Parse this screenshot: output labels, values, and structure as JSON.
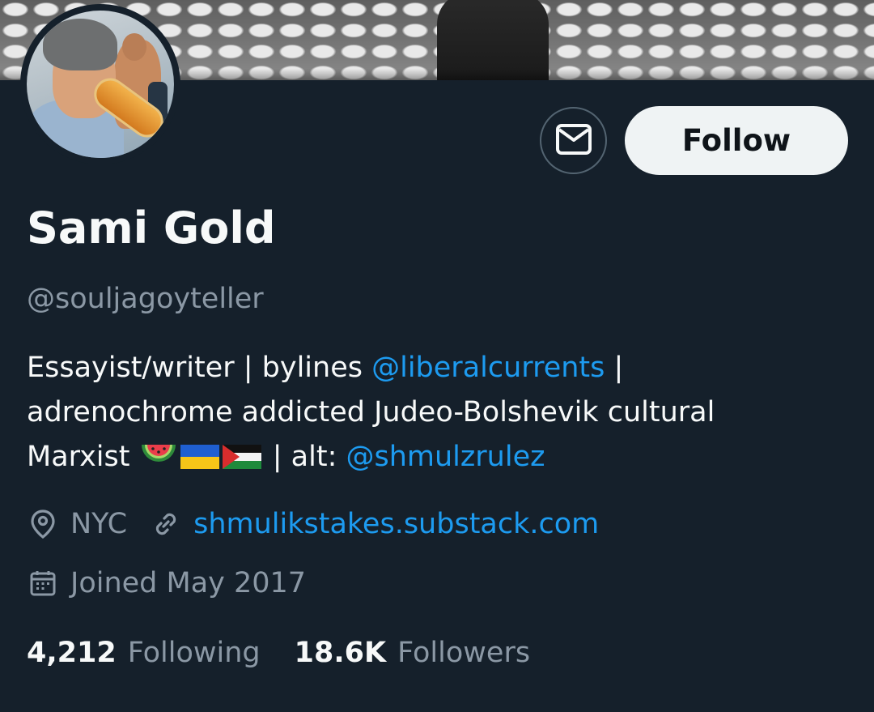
{
  "profile": {
    "name": "Sami Gold",
    "handle": "@souljagoyteller",
    "bio": {
      "line1_text": "Essayist/writer | bylines ",
      "line1_mention": "@liberalcurrents",
      "line1_tail": " |",
      "line2": "adrenochrome addicted Judeo-Bolshevik cultural",
      "line3_text": "Marxist ",
      "line3_alt_text": " | alt: ",
      "line3_mention": "@shmulzrulez",
      "emoji_names": [
        "watermelon-emoji",
        "ukraine-flag-emoji",
        "palestine-flag-emoji"
      ]
    },
    "location": "NYC",
    "website": "shmulikstakes.substack.com",
    "joined": "Joined May 2017",
    "following_count": "4,212",
    "following_label": "Following",
    "followers_count": "18.6K",
    "followers_label": "Followers"
  },
  "actions": {
    "follow_label": "Follow",
    "message_icon": "mail-icon"
  },
  "colors": {
    "background": "#15202b",
    "text_primary": "#f7f9f9",
    "text_secondary": "#8b98a5",
    "link": "#1d9bf0",
    "button_bg": "#eff3f4",
    "button_border": "#536471"
  }
}
